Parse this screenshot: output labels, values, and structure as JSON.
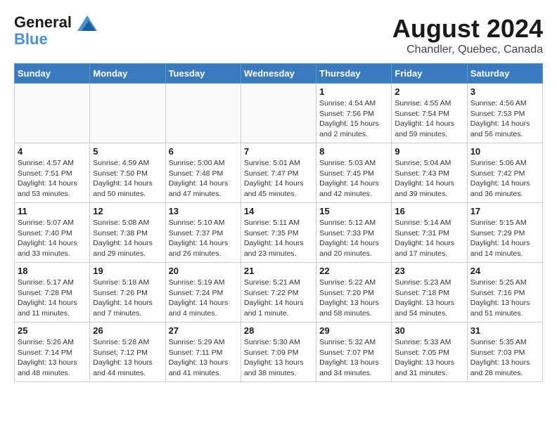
{
  "header": {
    "logo_line1": "General",
    "logo_line2": "Blue",
    "month_year": "August 2024",
    "location": "Chandler, Quebec, Canada"
  },
  "weekdays": [
    "Sunday",
    "Monday",
    "Tuesday",
    "Wednesday",
    "Thursday",
    "Friday",
    "Saturday"
  ],
  "weeks": [
    [
      {
        "day": "",
        "info": ""
      },
      {
        "day": "",
        "info": ""
      },
      {
        "day": "",
        "info": ""
      },
      {
        "day": "",
        "info": ""
      },
      {
        "day": "1",
        "info": "Sunrise: 4:54 AM\nSunset: 7:56 PM\nDaylight: 15 hours\nand 2 minutes."
      },
      {
        "day": "2",
        "info": "Sunrise: 4:55 AM\nSunset: 7:54 PM\nDaylight: 14 hours\nand 59 minutes."
      },
      {
        "day": "3",
        "info": "Sunrise: 4:56 AM\nSunset: 7:53 PM\nDaylight: 14 hours\nand 56 minutes."
      }
    ],
    [
      {
        "day": "4",
        "info": "Sunrise: 4:57 AM\nSunset: 7:51 PM\nDaylight: 14 hours\nand 53 minutes."
      },
      {
        "day": "5",
        "info": "Sunrise: 4:59 AM\nSunset: 7:50 PM\nDaylight: 14 hours\nand 50 minutes."
      },
      {
        "day": "6",
        "info": "Sunrise: 5:00 AM\nSunset: 7:48 PM\nDaylight: 14 hours\nand 47 minutes."
      },
      {
        "day": "7",
        "info": "Sunrise: 5:01 AM\nSunset: 7:47 PM\nDaylight: 14 hours\nand 45 minutes."
      },
      {
        "day": "8",
        "info": "Sunrise: 5:03 AM\nSunset: 7:45 PM\nDaylight: 14 hours\nand 42 minutes."
      },
      {
        "day": "9",
        "info": "Sunrise: 5:04 AM\nSunset: 7:43 PM\nDaylight: 14 hours\nand 39 minutes."
      },
      {
        "day": "10",
        "info": "Sunrise: 5:06 AM\nSunset: 7:42 PM\nDaylight: 14 hours\nand 36 minutes."
      }
    ],
    [
      {
        "day": "11",
        "info": "Sunrise: 5:07 AM\nSunset: 7:40 PM\nDaylight: 14 hours\nand 33 minutes."
      },
      {
        "day": "12",
        "info": "Sunrise: 5:08 AM\nSunset: 7:38 PM\nDaylight: 14 hours\nand 29 minutes."
      },
      {
        "day": "13",
        "info": "Sunrise: 5:10 AM\nSunset: 7:37 PM\nDaylight: 14 hours\nand 26 minutes."
      },
      {
        "day": "14",
        "info": "Sunrise: 5:11 AM\nSunset: 7:35 PM\nDaylight: 14 hours\nand 23 minutes."
      },
      {
        "day": "15",
        "info": "Sunrise: 5:12 AM\nSunset: 7:33 PM\nDaylight: 14 hours\nand 20 minutes."
      },
      {
        "day": "16",
        "info": "Sunrise: 5:14 AM\nSunset: 7:31 PM\nDaylight: 14 hours\nand 17 minutes."
      },
      {
        "day": "17",
        "info": "Sunrise: 5:15 AM\nSunset: 7:29 PM\nDaylight: 14 hours\nand 14 minutes."
      }
    ],
    [
      {
        "day": "18",
        "info": "Sunrise: 5:17 AM\nSunset: 7:28 PM\nDaylight: 14 hours\nand 11 minutes."
      },
      {
        "day": "19",
        "info": "Sunrise: 5:18 AM\nSunset: 7:26 PM\nDaylight: 14 hours\nand 7 minutes."
      },
      {
        "day": "20",
        "info": "Sunrise: 5:19 AM\nSunset: 7:24 PM\nDaylight: 14 hours\nand 4 minutes."
      },
      {
        "day": "21",
        "info": "Sunrise: 5:21 AM\nSunset: 7:22 PM\nDaylight: 14 hours\nand 1 minute."
      },
      {
        "day": "22",
        "info": "Sunrise: 5:22 AM\nSunset: 7:20 PM\nDaylight: 13 hours\nand 58 minutes."
      },
      {
        "day": "23",
        "info": "Sunrise: 5:23 AM\nSunset: 7:18 PM\nDaylight: 13 hours\nand 54 minutes."
      },
      {
        "day": "24",
        "info": "Sunrise: 5:25 AM\nSunset: 7:16 PM\nDaylight: 13 hours\nand 51 minutes."
      }
    ],
    [
      {
        "day": "25",
        "info": "Sunrise: 5:26 AM\nSunset: 7:14 PM\nDaylight: 13 hours\nand 48 minutes."
      },
      {
        "day": "26",
        "info": "Sunrise: 5:28 AM\nSunset: 7:12 PM\nDaylight: 13 hours\nand 44 minutes."
      },
      {
        "day": "27",
        "info": "Sunrise: 5:29 AM\nSunset: 7:11 PM\nDaylight: 13 hours\nand 41 minutes."
      },
      {
        "day": "28",
        "info": "Sunrise: 5:30 AM\nSunset: 7:09 PM\nDaylight: 13 hours\nand 38 minutes."
      },
      {
        "day": "29",
        "info": "Sunrise: 5:32 AM\nSunset: 7:07 PM\nDaylight: 13 hours\nand 34 minutes."
      },
      {
        "day": "30",
        "info": "Sunrise: 5:33 AM\nSunset: 7:05 PM\nDaylight: 13 hours\nand 31 minutes."
      },
      {
        "day": "31",
        "info": "Sunrise: 5:35 AM\nSunset: 7:03 PM\nDaylight: 13 hours\nand 28 minutes."
      }
    ]
  ]
}
